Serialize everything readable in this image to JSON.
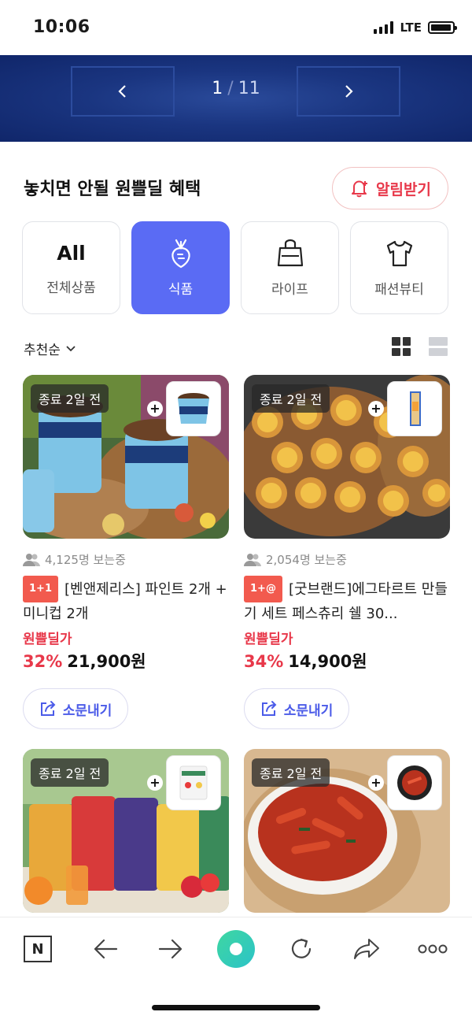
{
  "status_bar": {
    "time": "10:06",
    "network": "LTE",
    "battery_level": 0.95
  },
  "banner": {
    "current_page": "1",
    "separator": "/",
    "total_pages": "11"
  },
  "section": {
    "title": "놓치면 안될 원쁠딜 혜택",
    "alert_button": "알림받기"
  },
  "categories": [
    {
      "icon_text": "All",
      "label": "전체상품",
      "icon": "all-icon",
      "active": false
    },
    {
      "label": "식품",
      "icon": "radish-icon",
      "active": true
    },
    {
      "label": "라이프",
      "icon": "bag-icon",
      "active": false
    },
    {
      "label": "패션뷰티",
      "icon": "tshirt-icon",
      "active": false
    }
  ],
  "sort": {
    "label": "추천순"
  },
  "products": [
    {
      "ends_tag": "종료 2일 전",
      "viewers": "4,125명 보는중",
      "badge": "1+1",
      "title": "[벤앤제리스] 파인트 2개 + 미니컵 2개",
      "price_label": "원쁠딜가",
      "discount": "32%",
      "price": "21,900원",
      "share_label": "소문내기"
    },
    {
      "ends_tag": "종료 2일 전",
      "viewers": "2,054명 보는중",
      "badge": "1+@",
      "title": "[굿브랜드]에그타르트 만들기 세트 페스츄리 쉘 30...",
      "price_label": "원쁠딜가",
      "discount": "34%",
      "price": "14,900원",
      "share_label": "소문내기"
    },
    {
      "ends_tag": "종료 2일 전"
    },
    {
      "ends_tag": "종료 2일 전"
    }
  ],
  "colors": {
    "accent": "#5a6bf4",
    "deal_red": "#e8384a",
    "banner_bg": "#1a3580",
    "home_green": "#3fd7a1"
  },
  "browser_bar": {
    "icons": [
      "n-logo-icon",
      "back-arrow-icon",
      "forward-arrow-icon",
      "home-icon",
      "reload-icon",
      "share-icon",
      "more-icon"
    ]
  }
}
